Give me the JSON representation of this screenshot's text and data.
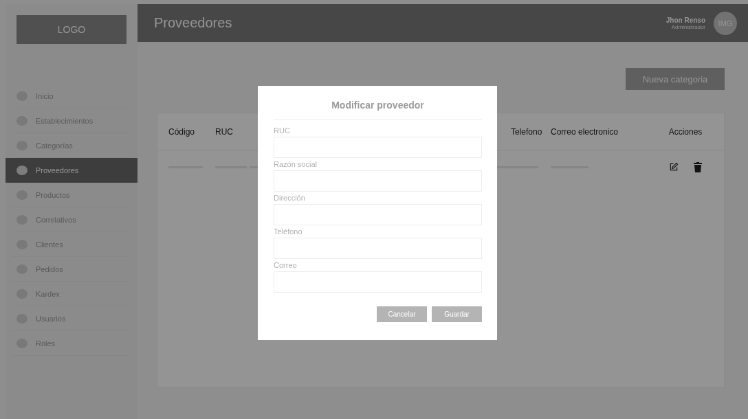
{
  "sidebar": {
    "logo": "LOGO",
    "items": [
      {
        "label": "Inicio",
        "selected": false
      },
      {
        "label": "Establecimientos",
        "selected": false
      },
      {
        "label": "Categorías",
        "selected": false
      },
      {
        "label": "Proveedores",
        "selected": true
      },
      {
        "label": "Productos",
        "selected": false
      },
      {
        "label": "Correlativos",
        "selected": false
      },
      {
        "label": "Clientes",
        "selected": false
      },
      {
        "label": "Pedidos",
        "selected": false
      },
      {
        "label": "Kardex",
        "selected": false
      },
      {
        "label": "Usuarios",
        "selected": false
      },
      {
        "label": "Roles",
        "selected": false
      }
    ]
  },
  "header": {
    "title": "Proveedores",
    "user": {
      "name": "Jhon Renso",
      "role": "Administrador",
      "avatar": "IMG"
    }
  },
  "toolbar": {
    "button": "Nueva categoria"
  },
  "table": {
    "columns": [
      "Código",
      "RUC",
      "Telefono",
      "Correo electronico",
      "Acciones"
    ],
    "rows": [
      {
        "kind": "placeholder"
      }
    ]
  },
  "modal": {
    "title": "Modificar proveedor",
    "fields": [
      {
        "label": "RUC"
      },
      {
        "label": "Razón social"
      },
      {
        "label": "Dirección"
      },
      {
        "label": "Teléfono"
      },
      {
        "label": "Correo"
      }
    ],
    "buttons": [
      "Cancelar",
      "Guardar"
    ]
  }
}
